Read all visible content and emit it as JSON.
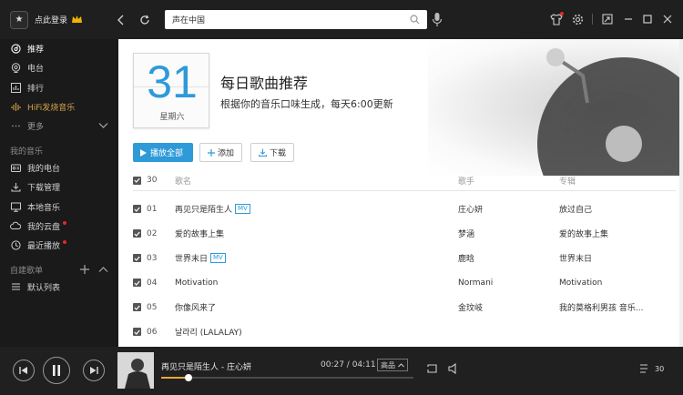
{
  "header": {
    "login_label": "点此登录",
    "search": {
      "value": "声在中国",
      "placeholder": ""
    }
  },
  "sidebar": {
    "items": [
      {
        "label": "推荐",
        "icon": "music-disc-icon",
        "active": true
      },
      {
        "label": "电台",
        "icon": "radio-icon"
      },
      {
        "label": "排行",
        "icon": "chart-icon"
      },
      {
        "label": "HiFi发烧音乐",
        "icon": "hifi-icon"
      },
      {
        "label": "更多",
        "icon": "more-icon"
      }
    ],
    "my_music_heading": "我的音乐",
    "my_music": [
      {
        "label": "我的电台",
        "icon": "my-radio-icon"
      },
      {
        "label": "下载管理",
        "icon": "download-icon"
      },
      {
        "label": "本地音乐",
        "icon": "monitor-icon"
      },
      {
        "label": "我的云盘",
        "icon": "cloud-icon",
        "dot": true
      },
      {
        "label": "最近播放",
        "icon": "history-icon",
        "dot": true
      }
    ],
    "playlist_heading": "自建歌单",
    "playlists": [
      {
        "label": "默认列表",
        "icon": "list-icon"
      }
    ]
  },
  "hero": {
    "day_number": "31",
    "weekday": "星期六",
    "title": "每日歌曲推荐",
    "subtitle": "根据你的音乐口味生成，每天6:00更新"
  },
  "actions": {
    "play_all": "播放全部",
    "add": "添加",
    "download": "下载"
  },
  "table": {
    "count": "30",
    "headers": {
      "name": "歌名",
      "artist": "歌手",
      "album": "专辑"
    },
    "rows": [
      {
        "idx": "01",
        "name": "再见只是陌生人",
        "mv": "MV",
        "artist": "庄心妍",
        "album": "放过自己"
      },
      {
        "idx": "02",
        "name": "爱的故事上集",
        "mv": "",
        "artist": "梦涵",
        "album": "爱的故事上集"
      },
      {
        "idx": "03",
        "name": "世界末日",
        "mv": "MV",
        "artist": "鹿晗",
        "album": "世界末日"
      },
      {
        "idx": "04",
        "name": "Motivation",
        "mv": "",
        "artist": "Normani",
        "album": "Motivation"
      },
      {
        "idx": "05",
        "name": "你像风来了",
        "mv": "",
        "artist": "金玟岐",
        "album": "我的莫格利男孩 音乐..."
      },
      {
        "idx": "06",
        "name": "날라리 (LALALAY)",
        "mv": "",
        "artist": "",
        "album": ""
      }
    ]
  },
  "player": {
    "now_playing": "再见只是陌生人 - 庄心妍",
    "time": "00:27 / 04:11",
    "quality": "高品",
    "progress": 0.11,
    "playlist_count": "30",
    "colors": {
      "accent": "#e8a93b",
      "primary": "#2f9ad8"
    }
  }
}
